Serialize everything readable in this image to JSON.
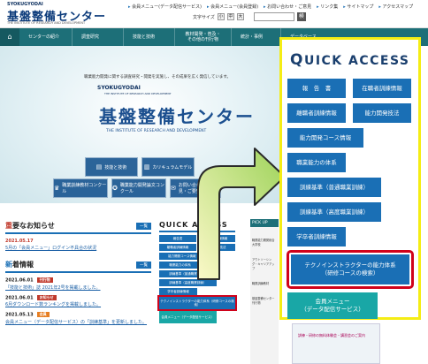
{
  "header": {
    "logo_small": "SYOKUGYODAI",
    "logo_main": "基盤整備センター",
    "logo_sub": "THE INSTITUTE OF RESEARCH AND DEVELOPMENT",
    "top_links": [
      "会員メニュー(データ配信サービス)",
      "会員メニュー(会員登録)",
      "お問い合わせ・ご意見",
      "リンク集",
      "サイトマップ",
      "アクセスマップ"
    ],
    "font_size_label": "文字サイズ",
    "font_sizes": [
      "小",
      "中",
      "大"
    ],
    "search_button": "検"
  },
  "nav": {
    "home_icon": "⌂",
    "items": [
      "センターの紹介",
      "調査研究",
      "技能と技術",
      "教材開発・普及・その他の刊行物",
      "統計・事例",
      "データベース"
    ]
  },
  "hero": {
    "tagline": "職業能力開発に関する調査研究・開発を実施し、その成果を広く発信しています。",
    "logo_small": "SYOKUGYODAI",
    "logo_en_line2": "THE INSTITUTE OF RESEARCH AND DEVELOPMENT",
    "title": "基盤整備センター",
    "subtitle": "THE INSTITUTE OF RESEARCH AND DEVELOPMENT",
    "buttons": [
      "技能と技術",
      "カリキュラムモデル",
      "職業訓練教材コンクール",
      "職業能力開発論文コンクール",
      "お問い合わせ・ご意見・ご要望"
    ]
  },
  "news": {
    "important_title_accent": "重",
    "important_title_rest": "要なお知らせ",
    "more_label": "一覧",
    "important_items": [
      {
        "date": "2021.05.17",
        "text": "5月の「会員メニュー」ログイン不具合の状況"
      }
    ],
    "new_title_accent": "新",
    "new_title_rest": "着情報",
    "new_items": [
      {
        "date": "2021.06.01",
        "badge": "刊行物",
        "text": "「技能と技術」誌 2021年2号を掲載しました。"
      },
      {
        "date": "2021.06.01",
        "badge": "お知らせ",
        "text": "6月ダウンロード数ランキングを掲載しました。"
      },
      {
        "date": "2021.05.13",
        "badge": "会員",
        "text": "会員メニュー（データ配信サービス）の「訓練基準」を更新しました。"
      }
    ]
  },
  "quick_access_small": {
    "title": "QUICK ACCESS",
    "items": [
      "報告書",
      "在職者訓練情報",
      "離職者訓練情報",
      "能力開発技法",
      "能力開発コース情報",
      "職業能力の体系",
      "訓練基準（普通職業訓練）",
      "訓練基準（高度職業訓練）",
      "学卒者訓練情報",
      "テクノインストラクターの能力体系（研修コースの検索）",
      "会員メニュー（データ配信サービス）"
    ]
  },
  "pickup": {
    "title": "PICK UP",
    "rows": [
      "職業能力開発総合大学校",
      "アウトソーシング・キャリアアップ",
      "職業訓練教材",
      "基盤整備センター刊行物"
    ]
  },
  "quick_access_big": {
    "title_first": "Q",
    "title_rest": "UICK ACCESS",
    "items": {
      "report": "報　告　書",
      "in_service": "在職者訓練情報",
      "unemployed": "離職者訓練情報",
      "techniques": "能力開発技法",
      "course_info": "能力開発コース情報",
      "competency": "職業能力の体系",
      "standard_normal": "訓練基準（普通職業訓練）",
      "standard_advanced": "訓練基準（高度職業訓練）",
      "graduates": "学卒者訓練情報",
      "techno_line1": "テクノインストラクターの能力体系",
      "techno_line2": "（研修コースの検索）",
      "member_line1": "会員メニュー",
      "member_line2": "（データ配信サービス）"
    }
  },
  "bottom_banner": {
    "text": "訓練・研修の無料体験会・講習会のご案内"
  },
  "colors": {
    "nav": "#1d6f78",
    "button": "#1a6fb5",
    "teal": "#19a7a6",
    "highlight_red": "#d0021b",
    "panel_border": "#f5ed14"
  }
}
